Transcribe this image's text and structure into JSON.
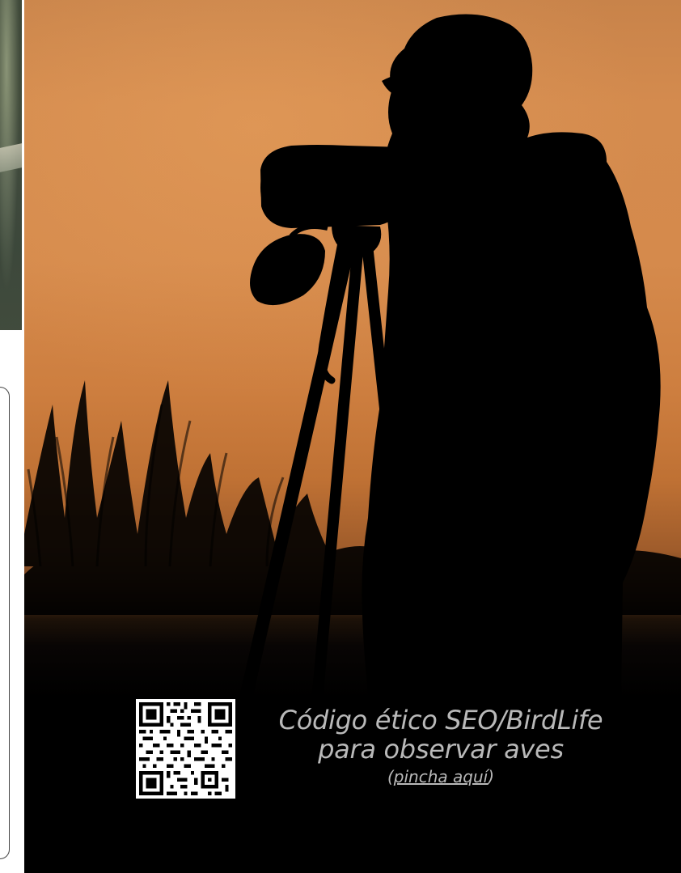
{
  "ethics": {
    "line1": "Código ético SEO/BirdLife",
    "line2": "para observar aves",
    "link_prefix": "(",
    "link_label": "pincha aquí",
    "link_suffix": ")"
  },
  "colors": {
    "sky_top": "#c8834a",
    "sky_mid": "#d58a4c",
    "sky_low": "#bf7134",
    "ground": "#000000",
    "text": "#b9b9b9"
  },
  "icons": {
    "qr": "qr-code-icon"
  }
}
